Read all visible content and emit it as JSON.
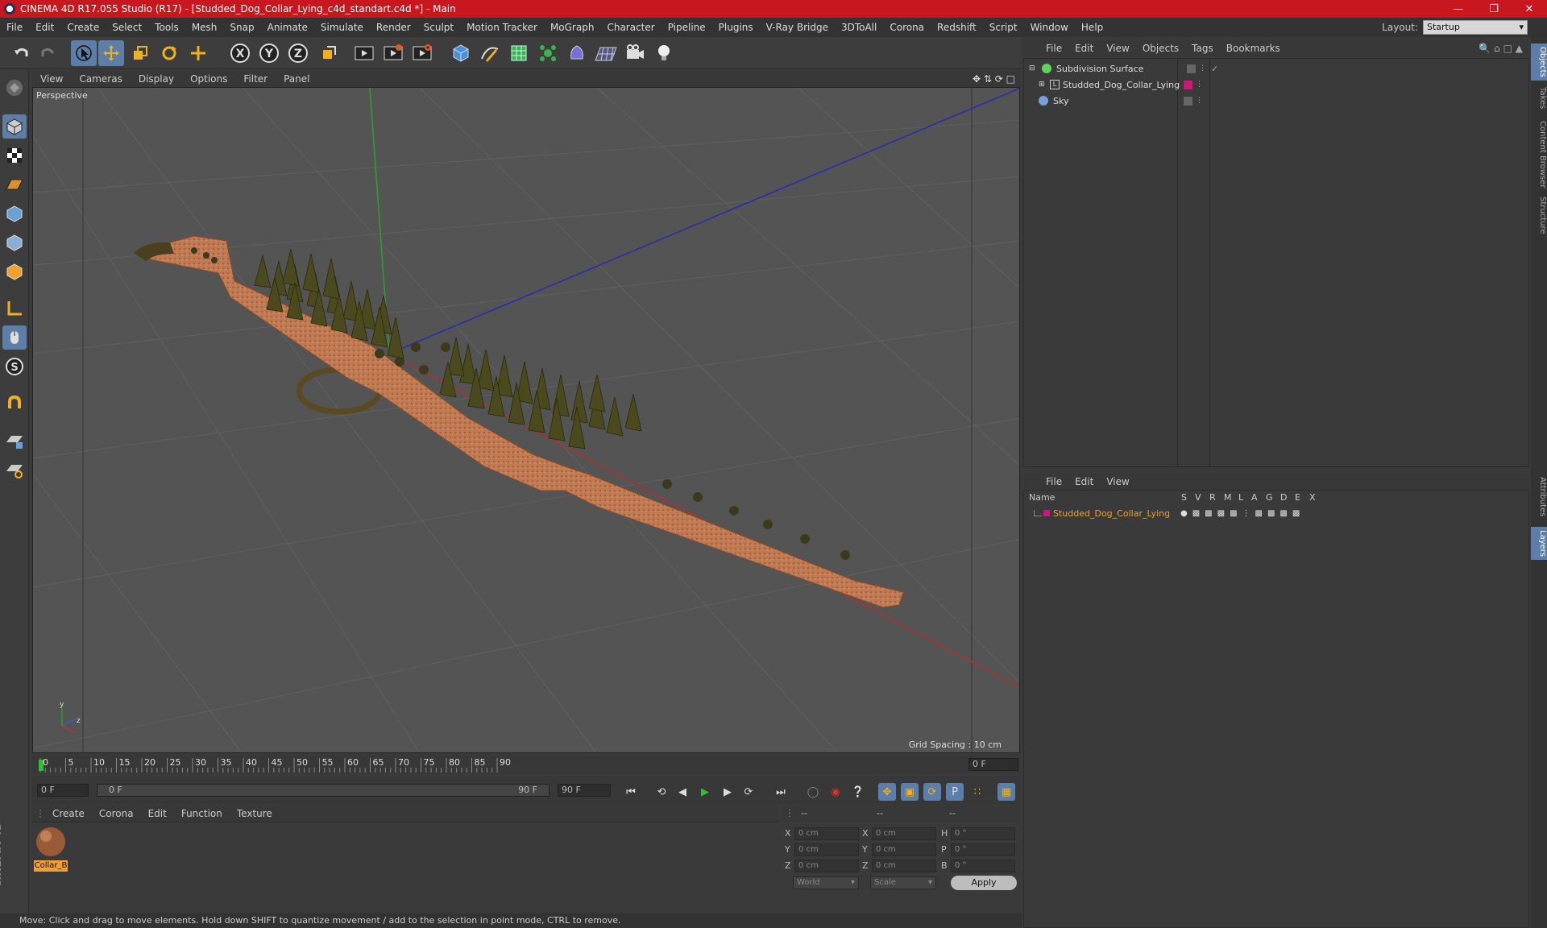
{
  "window": {
    "title": "CINEMA 4D R17.055 Studio (R17) - [Studded_Dog_Collar_Lying_c4d_standart.c4d *] - Main"
  },
  "menubar": {
    "items": [
      "File",
      "Edit",
      "Create",
      "Select",
      "Tools",
      "Mesh",
      "Snap",
      "Animate",
      "Simulate",
      "Render",
      "Sculpt",
      "Motion Tracker",
      "MoGraph",
      "Character",
      "Pipeline",
      "Plugins",
      "V-Ray Bridge",
      "3DToAll",
      "Corona",
      "Redshift",
      "Script",
      "Window",
      "Help"
    ],
    "layout_label": "Layout:",
    "layout_value": "Startup"
  },
  "toolbar": {
    "icons": [
      "undo-icon",
      "redo-icon",
      "select-arrow-icon",
      "move-icon",
      "scale-icon",
      "rotate-icon",
      "live-select-icon",
      "x-axis-icon",
      "y-axis-icon",
      "z-axis-icon",
      "coordinate-system-icon",
      "render-view-icon",
      "render-picture-viewer-icon",
      "edit-render-settings-icon",
      "cube-icon",
      "pen-spline-icon",
      "subdivision-icon",
      "cloner-icon",
      "deformer-icon",
      "floor-icon",
      "camera-icon",
      "light-icon"
    ]
  },
  "viewport": {
    "menu": [
      "View",
      "Cameras",
      "Display",
      "Options",
      "Filter",
      "Panel"
    ],
    "label": "Perspective",
    "grid_spacing": "Grid Spacing : 10 cm"
  },
  "timeline": {
    "ticks": [
      "0",
      "5",
      "10",
      "15",
      "20",
      "25",
      "30",
      "35",
      "40",
      "45",
      "50",
      "55",
      "60",
      "65",
      "70",
      "75",
      "80",
      "85",
      "90"
    ],
    "current_frame": "0 F",
    "start_field": "0 F",
    "slider_start": "0 F",
    "slider_end": "90 F",
    "end_field": "90 F"
  },
  "material_manager": {
    "menu": [
      "Create",
      "Corona",
      "Edit",
      "Function",
      "Texture"
    ],
    "materials": [
      {
        "name": "Collar_B"
      }
    ]
  },
  "coordinates": {
    "header": [
      "--",
      "--",
      "--"
    ],
    "rows": [
      {
        "axis": "X",
        "pos": "0 cm",
        "axis2": "X",
        "size": "0 cm",
        "rot_label": "H",
        "rot": "0 °"
      },
      {
        "axis": "Y",
        "pos": "0 cm",
        "axis2": "Y",
        "size": "0 cm",
        "rot_label": "P",
        "rot": "0 °"
      },
      {
        "axis": "Z",
        "pos": "0 cm",
        "axis2": "Z",
        "size": "0 cm",
        "rot_label": "B",
        "rot": "0 °"
      }
    ],
    "mode": "World",
    "size_mode": "Scale",
    "apply": "Apply"
  },
  "status": "Move: Click and drag to move elements. Hold down SHIFT to quantize movement / add to the selection in point mode, CTRL to remove.",
  "object_manager": {
    "menu": [
      "File",
      "Edit",
      "View",
      "Objects",
      "Tags",
      "Bookmarks"
    ],
    "objects": [
      {
        "name": "Subdivision Surface",
        "color": "#5fd35f"
      },
      {
        "name": "Studded_Dog_Collar_Lying",
        "color": "#cccccc"
      },
      {
        "name": "Sky",
        "color": "#7aa0d8"
      }
    ]
  },
  "layer_manager": {
    "menu": [
      "File",
      "Edit",
      "View"
    ],
    "columns": [
      "Name",
      "S",
      "V",
      "R",
      "M",
      "L",
      "A",
      "G",
      "D",
      "E",
      "X"
    ],
    "layers": [
      {
        "name": "Studded_Dog_Collar_Lying",
        "color": "#c8197a"
      }
    ]
  },
  "right_tabs": [
    "Objects",
    "Takes",
    "Content Browser",
    "Structure",
    "Attributes",
    "Layers"
  ],
  "branding": {
    "logo": "MAXON CINEMA 4D"
  },
  "colors": {
    "accent": "#5c7ea8",
    "title_bar": "#c8171e",
    "selected_text": "#f0a030"
  }
}
